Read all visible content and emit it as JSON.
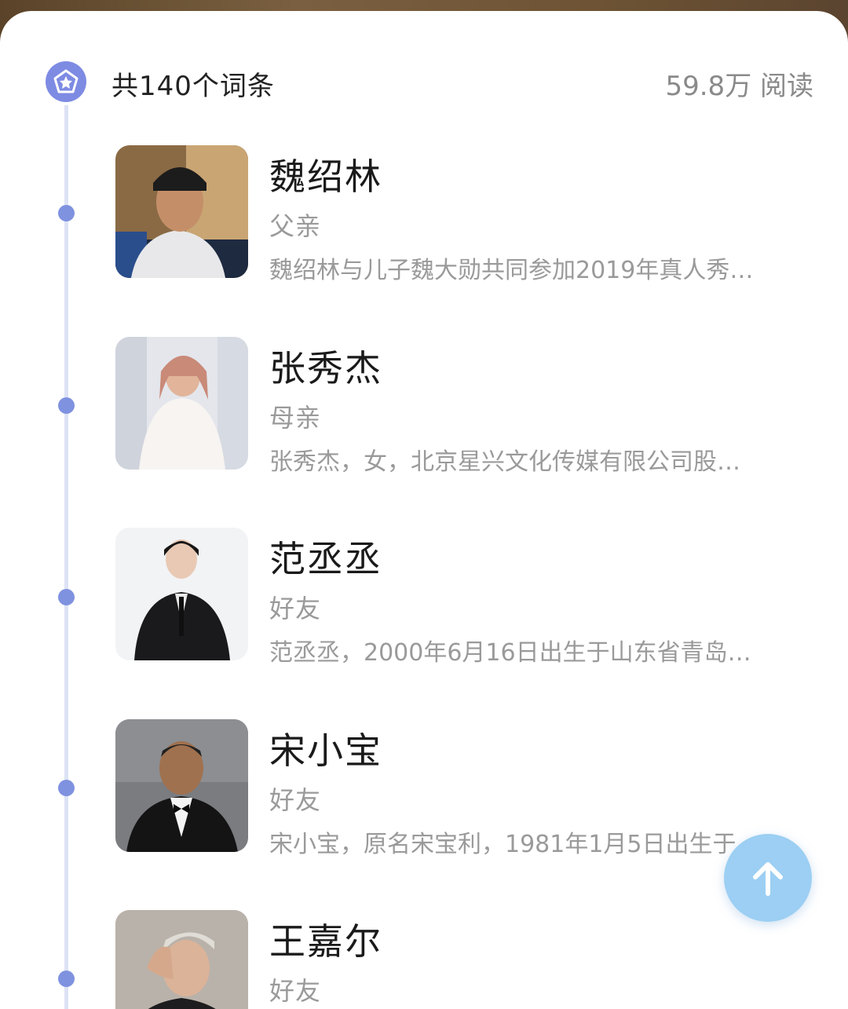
{
  "header": {
    "title": "共140个词条",
    "reads": "59.8万 阅读"
  },
  "entries": [
    {
      "name": "魏绍林",
      "relation": "父亲",
      "desc": "魏绍林与儿子魏大勋共同参加2019年真人秀…"
    },
    {
      "name": "张秀杰",
      "relation": "母亲",
      "desc": "张秀杰，女，北京星兴文化传媒有限公司股…"
    },
    {
      "name": "范丞丞",
      "relation": "好友",
      "desc": "范丞丞，2000年6月16日出生于山东省青岛…"
    },
    {
      "name": "宋小宝",
      "relation": "好友",
      "desc": "宋小宝，原名宋宝利，1981年1月5日出生于…"
    },
    {
      "name": "王嘉尔",
      "relation": "好友",
      "desc": ""
    }
  ],
  "icons": {
    "header": "pentagon-star-icon",
    "fab": "arrow-up-icon"
  },
  "colors": {
    "accent": "#7e8be3",
    "timeline_dot": "#7f92e0",
    "fab": "#9ccff3"
  }
}
